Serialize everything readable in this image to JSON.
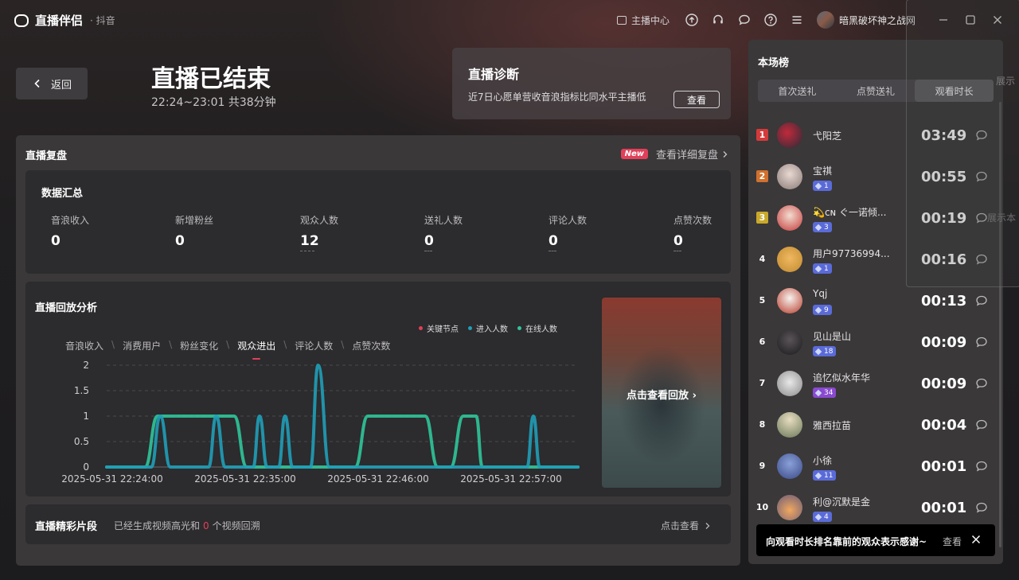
{
  "titlebar": {
    "app_name": "直播伴侣",
    "platform": "· 抖音",
    "host_center": "主播中心",
    "username": "暗黑破坏神之战网"
  },
  "header": {
    "back_label": "返回",
    "title": "直播已结束",
    "subtitle": "22:24~23:01 共38分钟"
  },
  "diagnosis": {
    "title": "直播诊断",
    "desc": "近7日心愿单营收音浪指标比同水平主播低",
    "button": "查看"
  },
  "review": {
    "title": "直播复盘",
    "new_badge": "New",
    "detail_link": "查看详细复盘",
    "summary_title": "数据汇总",
    "metrics": [
      {
        "label": "音浪收入",
        "value": "0"
      },
      {
        "label": "新增粉丝",
        "value": "0"
      },
      {
        "label": "观众人数",
        "value": "12"
      },
      {
        "label": "送礼人数",
        "value": "0"
      },
      {
        "label": "评论人数",
        "value": "0"
      },
      {
        "label": "点赞次数",
        "value": "0"
      }
    ],
    "analysis_title": "直播回放分析",
    "legend": [
      "关键节点",
      "进入人数",
      "在线人数"
    ],
    "tabs": [
      "音浪收入",
      "消费用户",
      "粉丝变化",
      "观众进出",
      "评论人数",
      "点赞次数"
    ],
    "active_tab": "观众进出",
    "replay_label": "点击查看回放",
    "clips_title": "直播精彩片段",
    "clips_desc_before": "已经生成视频高光和",
    "clips_count": "0",
    "clips_desc_after": "个视频回溯",
    "clips_link": "点击查看"
  },
  "chart_data": {
    "type": "line",
    "x_tick_labels": [
      "2025-05-31 22:24:00",
      "2025-05-31 22:35:00",
      "2025-05-31 22:46:00",
      "2025-05-31 22:57:00"
    ],
    "y_tick_labels": [
      "0",
      "0.5",
      "1",
      "1.5",
      "2"
    ],
    "ylim": [
      0,
      2
    ],
    "x_range_minutes": [
      0,
      37
    ],
    "series": [
      {
        "name": "进入人数",
        "color": "#1f9fb8",
        "x_minutes": [
          0,
          3.5,
          4.2,
          5,
          7,
          8,
          8.6,
          9.3,
          10,
          10.6,
          11.5,
          12,
          12.6,
          13.5,
          14,
          14.6,
          15.4,
          16,
          16.6,
          17.5,
          18.5,
          19.2,
          20,
          21,
          22,
          33,
          33.5,
          34,
          34.6,
          35.2,
          37
        ],
        "values": [
          0,
          0,
          1,
          0,
          0,
          0,
          1,
          0,
          0,
          0,
          0,
          1,
          0,
          0,
          1,
          0,
          0,
          0,
          2,
          0,
          0,
          0,
          0,
          0,
          0,
          0,
          1,
          0,
          0,
          0,
          0
        ]
      },
      {
        "name": "在线人数",
        "color": "#2fc59a",
        "x_minutes": [
          0,
          3,
          4,
          6,
          7.5,
          8.3,
          9.2,
          10,
          11,
          19.5,
          20.5,
          25,
          26,
          27,
          28,
          29,
          29.5,
          36,
          37
        ],
        "values": [
          0,
          0,
          1,
          1,
          1,
          1,
          1,
          1,
          0,
          0,
          1,
          1,
          0,
          0,
          1,
          1,
          0,
          0,
          0
        ]
      }
    ]
  },
  "ranking": {
    "title": "本场榜",
    "tabs": [
      "首次送礼",
      "点赞送礼",
      "观看时长"
    ],
    "active_tab": "观看时长",
    "rows": [
      {
        "rank": "1",
        "name": "弋阳芝",
        "badge": "",
        "time": "03:49"
      },
      {
        "rank": "2",
        "name": "宝祺",
        "badge": "1",
        "time": "00:55"
      },
      {
        "rank": "3",
        "name": "💫ᴄɴ ぐ一诺倾...",
        "badge": "3",
        "time": "00:19"
      },
      {
        "rank": "4",
        "name": "用户97736994...",
        "badge": "1",
        "time": "00:16"
      },
      {
        "rank": "5",
        "name": "Yqj",
        "badge": "9",
        "time": "00:13"
      },
      {
        "rank": "6",
        "name": "见山是山",
        "badge": "18",
        "time": "00:09"
      },
      {
        "rank": "7",
        "name": "追忆似水年华",
        "badge": "34",
        "time": "00:09"
      },
      {
        "rank": "8",
        "name": "雅西拉苗",
        "badge": "",
        "time": "00:04"
      },
      {
        "rank": "9",
        "name": "小徐",
        "badge": "11",
        "time": "00:01"
      },
      {
        "rank": "10",
        "name": "利@沉默是金",
        "badge": "4",
        "time": "00:01"
      }
    ]
  },
  "toast": {
    "text": "向观看时长排名靠前的观众表示感谢~",
    "view": "查看"
  },
  "overlay": {
    "text1": "展示",
    "text2": "展示本"
  },
  "colors": {
    "accent_red": "#e0405a",
    "key_node": "#e0405a",
    "enter": "#1f9fb8",
    "online": "#2fc59a"
  }
}
